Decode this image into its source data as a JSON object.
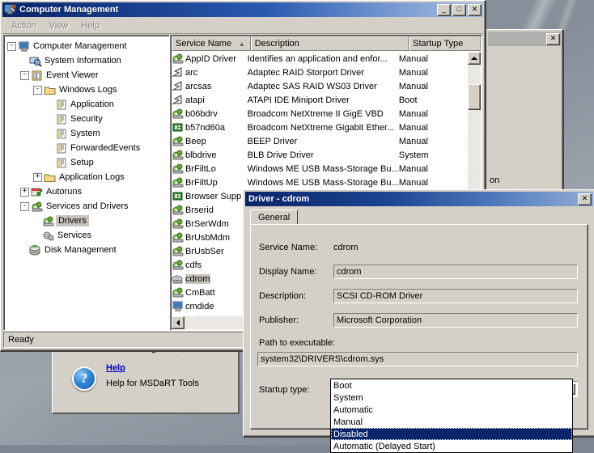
{
  "desktop": {
    "background_color": "#868d98"
  },
  "main_window": {
    "title": "Computer Management",
    "title_icon": "computer-management-icon",
    "window_buttons": [
      {
        "name": "minimize-button",
        "glyph": "_"
      },
      {
        "name": "maximize-button",
        "glyph": "□"
      },
      {
        "name": "close-button",
        "glyph": "✕"
      }
    ],
    "menus": [
      "Action",
      "View",
      "Help"
    ],
    "status_text": "Ready"
  },
  "tree": {
    "nodes": [
      {
        "label": "Computer Management",
        "indent": 0,
        "expander": "-",
        "icon": "computer-icon",
        "selected": false
      },
      {
        "label": "System Information",
        "indent": 1,
        "expander": "",
        "icon": "system-information-icon",
        "selected": false
      },
      {
        "label": "Event Viewer",
        "indent": 1,
        "expander": "-",
        "icon": "event-viewer-icon",
        "selected": false
      },
      {
        "label": "Windows Logs",
        "indent": 2,
        "expander": "-",
        "icon": "folder-icon",
        "selected": false
      },
      {
        "label": "Application",
        "indent": 3,
        "expander": "",
        "icon": "log-icon",
        "selected": false
      },
      {
        "label": "Security",
        "indent": 3,
        "expander": "",
        "icon": "log-icon",
        "selected": false
      },
      {
        "label": "System",
        "indent": 3,
        "expander": "",
        "icon": "log-icon",
        "selected": false
      },
      {
        "label": "ForwardedEvents",
        "indent": 3,
        "expander": "",
        "icon": "log-icon",
        "selected": false
      },
      {
        "label": "Setup",
        "indent": 3,
        "expander": "",
        "icon": "log-icon",
        "selected": false
      },
      {
        "label": "Application Logs",
        "indent": 2,
        "expander": "+",
        "icon": "folder-icon",
        "selected": false
      },
      {
        "label": "Autoruns",
        "indent": 1,
        "expander": "+",
        "icon": "autoruns-icon",
        "selected": false
      },
      {
        "label": "Services and Drivers",
        "indent": 1,
        "expander": "-",
        "icon": "services-icon",
        "selected": false
      },
      {
        "label": "Drivers",
        "indent": 2,
        "expander": "",
        "icon": "driver-icon",
        "selected": true
      },
      {
        "label": "Services",
        "indent": 2,
        "expander": "",
        "icon": "gears-icon",
        "selected": false
      },
      {
        "label": "Disk Management",
        "indent": 1,
        "expander": "",
        "icon": "disk-management-icon",
        "selected": false
      }
    ]
  },
  "list": {
    "columns": [
      {
        "label": "Service Name",
        "sort": "▲"
      },
      {
        "label": "Description",
        "sort": ""
      },
      {
        "label": "Startup Type",
        "sort": ""
      }
    ],
    "rows": [
      {
        "name": "AppID Driver",
        "desc": "Identifies an application and enfor...",
        "startup": "Manual",
        "icon": "driver-icon",
        "selected": false
      },
      {
        "name": "arc",
        "desc": "Adaptec RAID Storport Driver",
        "startup": "Manual",
        "icon": "flag-driver-icon",
        "selected": false
      },
      {
        "name": "arcsas",
        "desc": "Adaptec SAS RAID WS03 Driver",
        "startup": "Manual",
        "icon": "flag-driver-icon",
        "selected": false
      },
      {
        "name": "atapi",
        "desc": "ATAPI IDE Miniport Driver",
        "startup": "Boot",
        "icon": "flag-driver-icon",
        "selected": false
      },
      {
        "name": "b06bdrv",
        "desc": "Broadcom NetXtreme II GigE VBD",
        "startup": "Manual",
        "icon": "driver-icon",
        "selected": false
      },
      {
        "name": "b57nd60a",
        "desc": "Broadcom NetXtreme Gigabit Ether...",
        "startup": "Manual",
        "icon": "network-driver-icon",
        "selected": false
      },
      {
        "name": "Beep",
        "desc": "BEEP Driver",
        "startup": "Manual",
        "icon": "driver-icon",
        "selected": false
      },
      {
        "name": "blbdrive",
        "desc": "BLB Drive Driver",
        "startup": "System",
        "icon": "driver-icon",
        "selected": false
      },
      {
        "name": "BrFiltLo",
        "desc": "Windows ME USB Mass-Storage Bu...",
        "startup": "Manual",
        "icon": "driver-icon",
        "selected": false
      },
      {
        "name": "BrFiltUp",
        "desc": "Windows ME USB Mass-Storage Bu...",
        "startup": "Manual",
        "icon": "driver-icon",
        "selected": false
      },
      {
        "name": "Browser Supp",
        "desc": "",
        "startup": "",
        "icon": "network-driver-icon",
        "selected": false
      },
      {
        "name": "Brserid",
        "desc": "",
        "startup": "",
        "icon": "driver-icon",
        "selected": false
      },
      {
        "name": "BrSerWdm",
        "desc": "",
        "startup": "",
        "icon": "driver-icon",
        "selected": false
      },
      {
        "name": "BrUsbMdm",
        "desc": "",
        "startup": "",
        "icon": "driver-icon",
        "selected": false
      },
      {
        "name": "BrUsbSer",
        "desc": "",
        "startup": "",
        "icon": "driver-icon",
        "selected": false
      },
      {
        "name": "cdfs",
        "desc": "",
        "startup": "",
        "icon": "driver-icon",
        "selected": false
      },
      {
        "name": "cdrom",
        "desc": "",
        "startup": "",
        "icon": "cdrom-icon",
        "selected": true
      },
      {
        "name": "CmBatt",
        "desc": "",
        "startup": "",
        "icon": "driver-icon",
        "selected": false
      },
      {
        "name": "cmdide",
        "desc": "",
        "startup": "",
        "icon": "computer-icon",
        "selected": false
      }
    ]
  },
  "background_window": {
    "close_glyph": "✕",
    "text_fragment": "on"
  },
  "help_panel": {
    "clipped_text": "Disk Management, Services and",
    "link": "Help",
    "subtitle": "Help for MSDaRT Tools",
    "icon": "question-mark-icon"
  },
  "dialog": {
    "title": "Driver - cdrom",
    "close_glyph": "✕",
    "tabs": [
      {
        "label": "General",
        "active": true
      }
    ],
    "fields": [
      {
        "label": "Service Name:",
        "value": "cdrom",
        "boxed": false
      },
      {
        "label": "Display Name:",
        "value": "cdrom",
        "boxed": true
      },
      {
        "label": "Description:",
        "value": "SCSI CD-ROM Driver",
        "boxed": true
      },
      {
        "label": "Publisher:",
        "value": "Microsoft Corporation",
        "boxed": true
      }
    ],
    "path_label": "Path to executable:",
    "path_value": "system32\\DRIVERS\\cdrom.sys",
    "startup_label": "Startup type:",
    "startup_value": "Disabled",
    "startup_options": [
      {
        "label": "Boot",
        "selected": false
      },
      {
        "label": "System",
        "selected": false
      },
      {
        "label": "Automatic",
        "selected": false
      },
      {
        "label": "Manual",
        "selected": false
      },
      {
        "label": "Disabled",
        "selected": true
      },
      {
        "label": "Automatic (Delayed Start)",
        "selected": false
      }
    ]
  }
}
